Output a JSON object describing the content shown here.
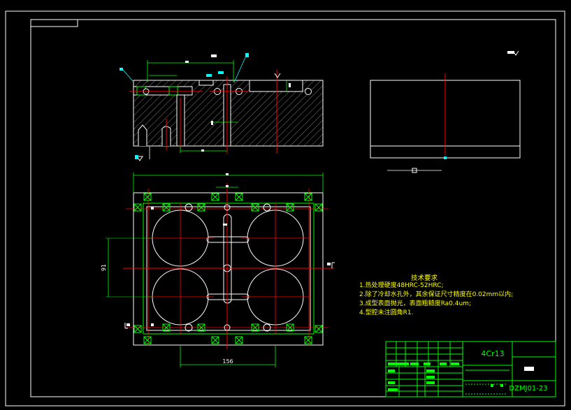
{
  "drawing": {
    "material": "4Cr13",
    "drawing_number": "DZMJ01-23",
    "dimensions": {
      "bottom_width": "156",
      "left_height": "91"
    }
  },
  "technical_requirements": {
    "title": "技术要求",
    "items": [
      "1.热处理硬度48HRC-52HRC;",
      "2.除了冷却水孔外，其余保证尺寸精度在0.02mm以内;",
      "3.成型表面抛光，表面粗糙度Ra0.4um;",
      "4.型腔未注圆角R1."
    ]
  },
  "colors": {
    "background": "#000000",
    "outline": "#ffffff",
    "centerline": "#ff0000",
    "dimension": "#00ff00",
    "hatch": "#ffffff",
    "text": "#ffff00",
    "leader": "#00ffff"
  }
}
